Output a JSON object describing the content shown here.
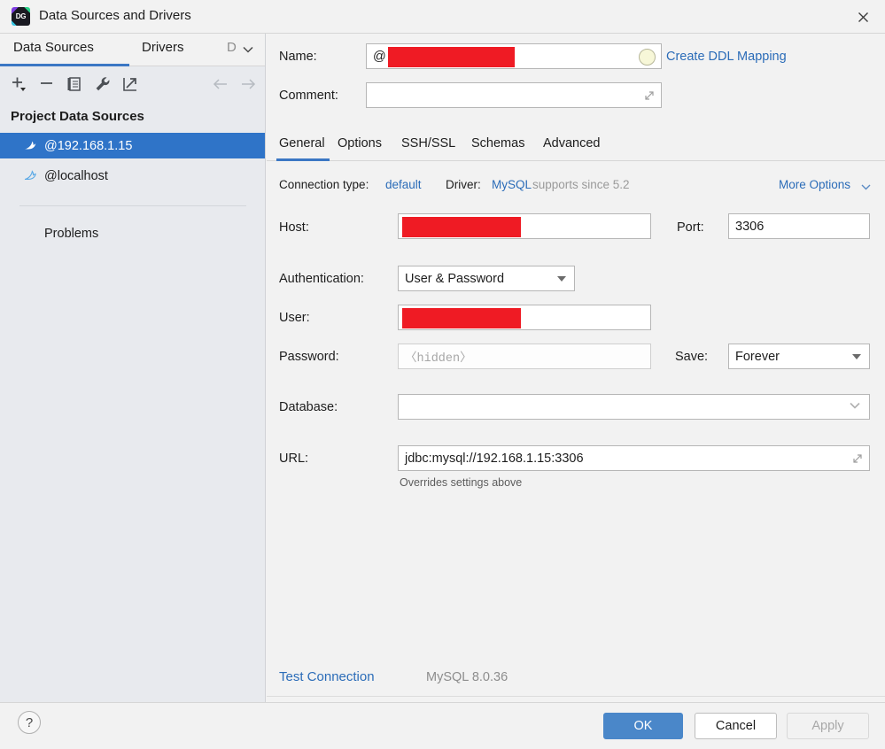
{
  "window": {
    "title": "Data Sources and Drivers",
    "app_icon": "datagrip-icon",
    "icon_text": "DG",
    "close_label": "✕"
  },
  "sidebar": {
    "tabs": [
      {
        "label": "Data Sources",
        "active": true
      },
      {
        "label": "Drivers",
        "active": false
      },
      {
        "label": "D",
        "active": false
      }
    ],
    "toolbar": [
      {
        "name": "add-button",
        "icon": "plus-icon"
      },
      {
        "name": "remove-button",
        "icon": "minus-icon"
      },
      {
        "name": "duplicate-button",
        "icon": "copy-icon"
      },
      {
        "name": "properties-button",
        "icon": "wrench-icon"
      },
      {
        "name": "export-button",
        "icon": "export-arrow-icon"
      },
      {
        "name": "back-button",
        "icon": "arrow-left-icon"
      },
      {
        "name": "forward-button",
        "icon": "arrow-right-icon"
      }
    ],
    "group_header": "Project Data Sources",
    "items": [
      {
        "label": "@192.168.1.15",
        "icon": "mysql-dolphin-icon",
        "selected": true
      },
      {
        "label": "@localhost",
        "icon": "mysql-dolphin-icon",
        "selected": false
      }
    ],
    "problems_label": "Problems"
  },
  "form": {
    "name_label": "Name:",
    "name_value": "@",
    "name_redacted": true,
    "comment_label": "Comment:",
    "comment_value": "",
    "create_ddl_mapping": "Create DDL Mapping"
  },
  "tabs": [
    {
      "label": "General",
      "active": true
    },
    {
      "label": "Options",
      "active": false
    },
    {
      "label": "SSH/SSL",
      "active": false
    },
    {
      "label": "Schemas",
      "active": false
    },
    {
      "label": "Advanced",
      "active": false
    }
  ],
  "meta": {
    "connection_type_label": "Connection type:",
    "connection_type_value": "default",
    "driver_label": "Driver:",
    "driver_value": "MySQL",
    "driver_note": "supports since 5.2",
    "more_options": "More Options"
  },
  "fields": {
    "host_label": "Host:",
    "host_value": "",
    "host_redacted": true,
    "port_label": "Port:",
    "port_value": "3306",
    "auth_label": "Authentication:",
    "auth_value": "User & Password",
    "user_label": "User:",
    "user_value": "",
    "user_redacted": true,
    "password_label": "Password:",
    "password_placeholder": "〈hidden〉",
    "save_label": "Save:",
    "save_value": "Forever",
    "database_label": "Database:",
    "database_value": "",
    "url_label": "URL:",
    "url_value": "jdbc:mysql://192.168.1.15:3306",
    "url_hint": "Overrides settings above"
  },
  "footer": {
    "test_connection": "Test Connection",
    "driver_version": "MySQL 8.0.36",
    "help_label": "?",
    "ok_label": "OK",
    "cancel_label": "Cancel",
    "apply_label": "Apply"
  },
  "colors": {
    "accent": "#3b77c4",
    "selection": "#2f74c8",
    "link": "#2b6cb8",
    "redaction": "#ef1b24",
    "primary_button": "#4a87c9"
  }
}
